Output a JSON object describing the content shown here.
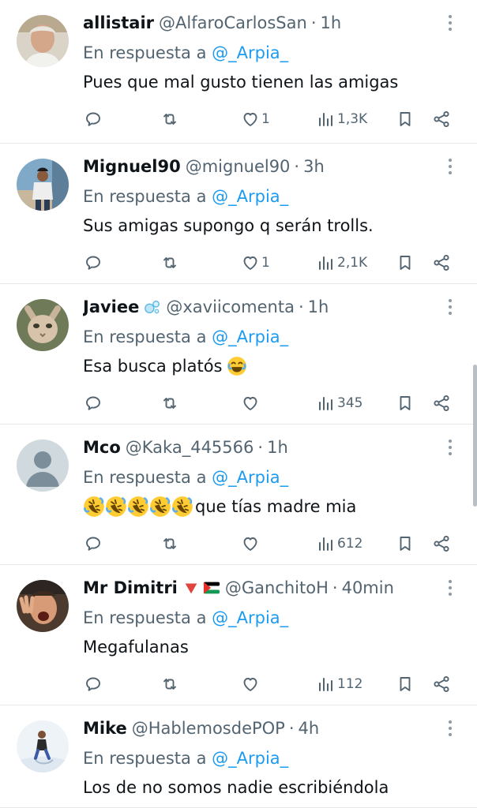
{
  "reply_prefix": "En respuesta a",
  "colors": {
    "link": "#1d9bf0",
    "secondary": "#536471",
    "text": "#0f1419"
  },
  "tweets": [
    {
      "name": "allistair",
      "handle": "@AlfaroCarlosSan",
      "separator": "·",
      "time": "1h",
      "reply_to": "@_Arpia_",
      "text": "Pues que mal gusto tienen las amigas",
      "likes": "1",
      "views": "1,3K",
      "avatar_icon": "gray-haired-man-avatar"
    },
    {
      "name": "Mignuel90",
      "handle": "@mignuel90",
      "separator": "·",
      "time": "3h",
      "reply_to": "@_Arpia_",
      "text": "Sus amigas supongo q serán trolls.",
      "likes": "1",
      "views": "2,1K",
      "avatar_icon": "man-in-street-avatar"
    },
    {
      "name": "Javiee",
      "badges": [
        "bubbles-emoji"
      ],
      "handle": "@xaviicomenta",
      "separator": "·",
      "time": "1h",
      "reply_to": "@_Arpia_",
      "text": "Esa busca platós",
      "emoji_suffix": [
        "joy-emoji"
      ],
      "likes": "",
      "views": "345",
      "avatar_icon": "hairless-cat-avatar"
    },
    {
      "name": "Mco",
      "handle": "@Kaka_445566",
      "separator": "·",
      "time": "1h",
      "reply_to": "@_Arpia_",
      "emoji_prefix": [
        "rofl-emoji",
        "rofl-emoji",
        "rofl-emoji",
        "rofl-emoji",
        "rofl-emoji"
      ],
      "text": "que tías madre mia",
      "likes": "",
      "views": "612",
      "avatar_icon": "default-person-avatar"
    },
    {
      "name": "Mr Dimitri",
      "badges": [
        "red-triangle-emoji",
        "palestine-flag-emoji"
      ],
      "handle": "@GanchitoH",
      "separator": "·",
      "time": "40min",
      "reply_to": "@_Arpia_",
      "text": "Megafulanas",
      "likes": "",
      "views": "112",
      "avatar_icon": "shouting-man-avatar"
    },
    {
      "name": "Mike",
      "handle": "@HablemosdePOP",
      "separator": "·",
      "time": "4h",
      "reply_to": "@_Arpia_",
      "text": "Los de no somos nadie escribiéndola",
      "avatar_icon": "person-in-snow-avatar"
    }
  ]
}
